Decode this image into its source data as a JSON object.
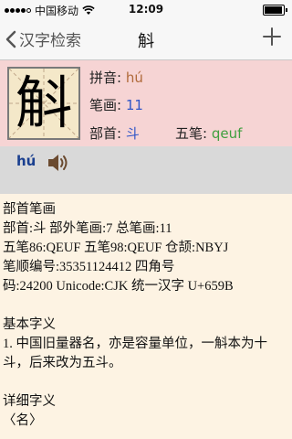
{
  "status": {
    "carrier": "中国移动",
    "time": "12:09"
  },
  "nav": {
    "back_label": "汉字检索",
    "title": "斛"
  },
  "character": {
    "glyph": "斛",
    "pinyin_label": "拼音:",
    "pinyin": "hú",
    "strokes_label": "笔画:",
    "strokes": "11",
    "radical_label": "部首:",
    "radical": "斗",
    "wubi_label": "五笔:",
    "wubi": "qeuf"
  },
  "audio": {
    "pinyin": "hú"
  },
  "content": {
    "radical_header": "部首笔画",
    "radical_line1": "部首:斗  部外笔画:7  总笔画:11",
    "radical_line2": "五笔86:QEUF  五笔98:QEUF  仓颉:NBYJ",
    "radical_line3": "笔顺编号:35351124412   四角号",
    "radical_line4": "码:24200  Unicode:CJK 统一汉字 U+659B",
    "basic_header": "基本字义",
    "basic_line1": "1. 中国旧量器名，亦是容量单位，一斛本为十",
    "basic_line2": "斗，后来改为五斗。",
    "detail_header": "详细字义",
    "detail_line1": "〈名〉"
  }
}
